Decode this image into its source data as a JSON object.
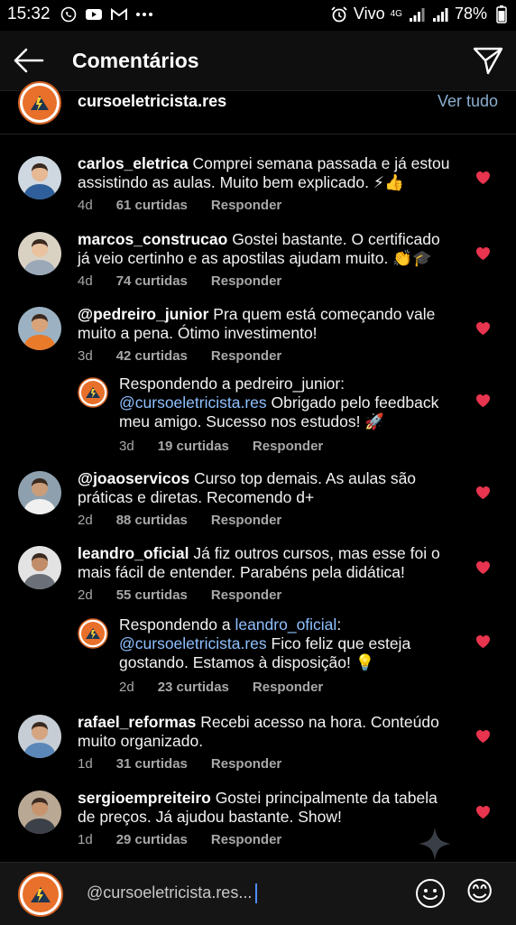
{
  "status_bar": {
    "time": "15:32",
    "carrier": "Vivo",
    "network": "4G",
    "battery": "78%"
  },
  "header": {
    "title": "Comentários"
  },
  "post": {
    "username": "cursoeletricista.res",
    "view_all": "Ver tudo"
  },
  "comments": [
    {
      "username": "carlos_eletrica",
      "text": " Comprei semana passada e já estou assistindo as aulas. Muito bem explicado. ⚡👍",
      "age": "4d",
      "likes": "61 curtidas",
      "reply": "Responder"
    },
    {
      "username": "marcos_construcao",
      "text": " Gostei bastante. O certificado já veio certinho e as apostilas ajudam muito. 👏🎓",
      "age": "4d",
      "likes": "74 curtidas",
      "reply": "Responder"
    },
    {
      "username": "@pedreiro_junior",
      "text": " Pra quem está começando vale muito a pena. Ótimo investimento!",
      "age": "3d",
      "likes": "42 curtidas",
      "reply": "Responder"
    },
    {
      "prefix": "Respondendo a pedreiro_junior:",
      "mention": "@cursoeletricista.res",
      "text": " Obrigado pelo feedback meu amigo. Sucesso nos estudos! 🚀",
      "age": "3d",
      "likes": "19 curtidas",
      "reply": "Responder"
    },
    {
      "username": "@joaoservicos",
      "text": " Curso top demais. As aulas são práticas e diretas. Recomendo d+",
      "age": "2d",
      "likes": "88 curtidas",
      "reply": "Responder"
    },
    {
      "username": "leandro_oficial",
      "text": " Já fiz outros cursos, mas esse foi o mais fácil de entender. Parabéns pela didática!",
      "age": "2d",
      "likes": "55 curtidas",
      "reply": "Responder"
    },
    {
      "prefix": "Respondendo a ",
      "prefix_user": "leandro_oficial",
      "prefix_end": ":",
      "mention": "@cursoeletricista.res",
      "text": " Fico feliz que esteja gostando. Estamos à disposição! 💡",
      "age": "2d",
      "likes": "23 curtidas",
      "reply": "Responder"
    },
    {
      "username": "rafael_reformas",
      "text": " Recebi acesso na hora. Conteúdo muito organizado.",
      "age": "1d",
      "likes": "31 curtidas",
      "reply": "Responder"
    },
    {
      "username": "sergioempreiteiro",
      "text": " Gostei principalmente da tabela de preços. Já ajudou bastante. Show!",
      "age": "1d",
      "likes": "29 curtidas",
      "reply": "Responder"
    }
  ],
  "composer": {
    "value": "@cursoeletricista.res...",
    "emoji": "😊"
  },
  "colors": {
    "accent_blue": "#8ec0ff",
    "heart_red": "#e8344e",
    "background": "#000000"
  }
}
